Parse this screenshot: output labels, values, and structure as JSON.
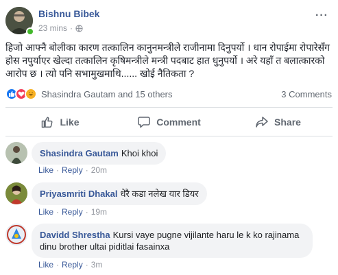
{
  "post": {
    "author": "Bishnu Bibek",
    "time": "23 mins",
    "more_glyph": "···",
    "text": "हिजो आफ्नै बोलीका कारण तत्कालिन कानुनमन्त्रीले राजीनामा दिनुपर्यो । धान रोपाईमा रोपारेसँग होस नपुर्याएर खेल्दा तत्कालिन कृषिमन्त्रीले मन्त्री पदबाट हात धुनुपर्यो । अरे यहाँ त बलात्कारको आरोप छ । त्यो पनि सभामुखमाथि...... खोई नैतिकता ?",
    "reactions_text": "Shasindra Gautam and 15 others",
    "comments_count": "3 Comments",
    "colors": {
      "link": "#385898",
      "like": "#1877f2",
      "love": "#f33e58",
      "haha": "#f7b125"
    }
  },
  "actions": {
    "like": "Like",
    "comment": "Comment",
    "share": "Share"
  },
  "comments": [
    {
      "name": "Shasindra Gautam",
      "text": "Khoi khoi",
      "like": "Like",
      "reply": "Reply",
      "time": "20m"
    },
    {
      "name": "Priyasmriti Dhakal",
      "text": "धेरै कडा नलेख यार डियर",
      "like": "Like",
      "reply": "Reply",
      "time": "19m"
    },
    {
      "name": "Davidd Shrestha",
      "text": "Kursi vaye pugne vijilante haru le k ko rajinama dinu brother ultai piditlai fasainxa",
      "like": "Like",
      "reply": "Reply",
      "time": "3m"
    }
  ]
}
